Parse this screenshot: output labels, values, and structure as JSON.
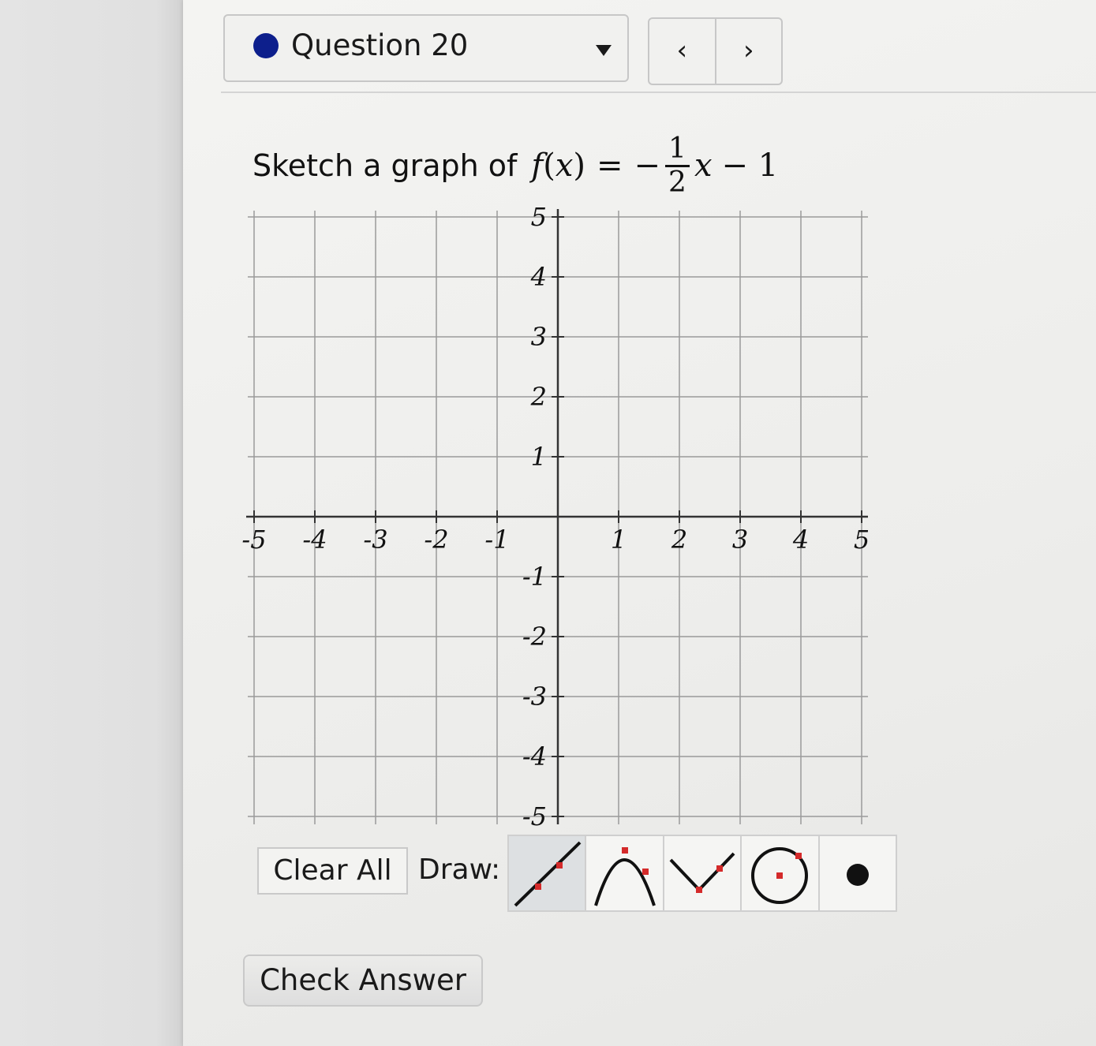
{
  "question": {
    "label": "Question 20",
    "dot_color": "#0d1f8c",
    "dropdown_icon": "caret-down-icon"
  },
  "nav": {
    "prev_icon": "chevron-left-icon",
    "prev_glyph": "‹",
    "next_icon": "chevron-right-icon",
    "next_glyph": "›"
  },
  "prompt": {
    "text": "Sketch a graph of",
    "fn": "f",
    "var": "x",
    "equals": "=",
    "minus": "−",
    "numerator": "1",
    "denominator": "2",
    "tail": "− 1"
  },
  "graph": {
    "x_ticks": [
      "-5",
      "-4",
      "-3",
      "-2",
      "-1",
      "1",
      "2",
      "3",
      "4",
      "5"
    ],
    "y_ticks": [
      "5",
      "4",
      "3",
      "2",
      "1",
      "-1",
      "-2",
      "-3",
      "-4",
      "-5"
    ],
    "xlim": [
      -5,
      5
    ],
    "ylim": [
      -5,
      5
    ],
    "grid": true
  },
  "toolbar": {
    "clear_label": "Clear All",
    "draw_label": "Draw:",
    "tools": [
      {
        "name": "line-tool-icon",
        "active": true
      },
      {
        "name": "parabola-tool-icon",
        "active": false
      },
      {
        "name": "absolute-value-tool-icon",
        "active": false
      },
      {
        "name": "circle-tool-icon",
        "active": false
      },
      {
        "name": "point-tool-icon",
        "active": false
      }
    ],
    "accent": "#d42a2a"
  },
  "check_label": "Check Answer"
}
